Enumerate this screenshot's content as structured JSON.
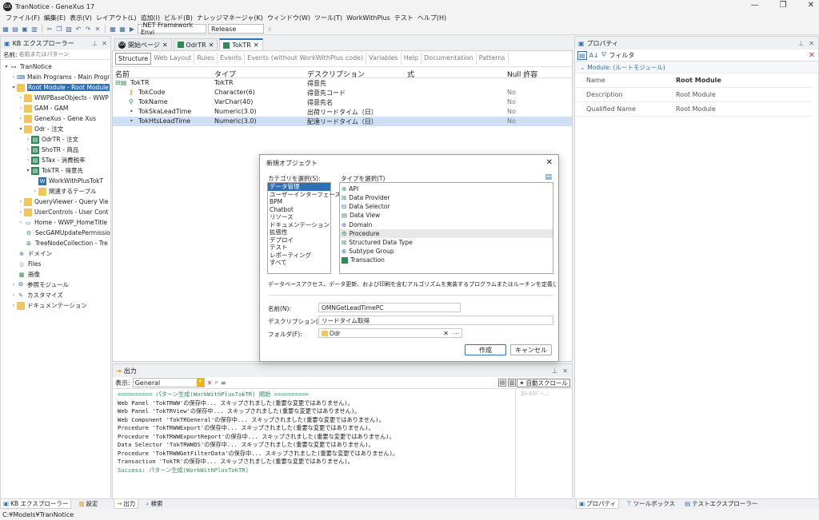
{
  "window": {
    "title": "TranNotice - GeneXus 17",
    "logo_text": "GX",
    "controls": [
      "—",
      "❐",
      "✕"
    ]
  },
  "menu": [
    "ファイル(F)",
    "編集(E)",
    "表示(V)",
    "レイアウト(L)",
    "追加(I)",
    "ビルド(B)",
    "ナレッジマネージャ(K)",
    "ウィンドウ(W)",
    "ツール(T)",
    "WorkWithPlus",
    "テスト",
    "ヘルプ(H)"
  ],
  "toolbar": {
    "environment": ".NET Framework Envi",
    "configuration": "Release"
  },
  "kb_explorer": {
    "title": "KB エクスプローラー",
    "search_label": "名前:",
    "search_placeholder": "名前またはパターン",
    "items": [
      {
        "label": "TranNotice",
        "icon": "kb-root-icon"
      },
      {
        "label": "Main Programs - Main Progr",
        "icon": "main-programs-icon"
      },
      {
        "label": "Root Module - Root Module",
        "icon": "module-icon",
        "selected": true
      },
      {
        "label": "WWPBaseObjects - WWP",
        "icon": "folder-icon"
      },
      {
        "label": "GAM - GAM",
        "icon": "folder-icon"
      },
      {
        "label": "GeneXus - Gene Xus",
        "icon": "folder-icon"
      },
      {
        "label": "Odr - 注文",
        "icon": "folder-icon"
      },
      {
        "label": "OdrTR - 注文",
        "icon": "transaction-icon"
      },
      {
        "label": "ShoTR - 商品",
        "icon": "transaction-icon"
      },
      {
        "label": "STax - 消費税率",
        "icon": "transaction-icon"
      },
      {
        "label": "TokTR - 得意先",
        "icon": "transaction-icon"
      },
      {
        "label": "WorkWithPlusTokT",
        "icon": "workwithplus-icon"
      },
      {
        "label": "関連するテーブル",
        "icon": "folder-icon"
      },
      {
        "label": "QueryViewer - Query Vie",
        "icon": "folder-icon"
      },
      {
        "label": "UserControls - User Cont",
        "icon": "folder-icon"
      },
      {
        "label": "Home - WWP_HomeTitle",
        "icon": "web-panel-icon"
      },
      {
        "label": "SecGAMUpdatePermissio",
        "icon": "procedure-icon"
      },
      {
        "label": "TreeNodeCollection - Tre",
        "icon": "sdt-icon"
      },
      {
        "label": "ドメイン",
        "icon": "domain-icon"
      },
      {
        "label": "Files",
        "icon": "files-icon"
      },
      {
        "label": "画像",
        "icon": "images-icon"
      },
      {
        "label": "参照モジュール",
        "icon": "references-icon"
      },
      {
        "label": "カスタマイズ",
        "icon": "customize-icon"
      },
      {
        "label": "ドキュメンテーション",
        "icon": "documentation-icon"
      }
    ]
  },
  "document_tabs": [
    {
      "label": "開始ページ"
    },
    {
      "label": "OdrTR"
    },
    {
      "label": "TokTR",
      "active": true
    }
  ],
  "sub_tabs": [
    "Structure",
    "Web Layout",
    "Rules",
    "Events",
    "Events (without WorkWithPlus code)",
    "Variables",
    "Help",
    "Documentation",
    "Patterns"
  ],
  "structure": {
    "headers": [
      "名前",
      "タイプ",
      "デスクリプション",
      "式",
      "Null 許容"
    ],
    "rows": [
      {
        "name": "TokTR",
        "type": "TokTR",
        "desc": "得意先",
        "formula": "",
        "nullable": ""
      },
      {
        "name": "TokCode",
        "type": "Character(6)",
        "desc": "得意先コード",
        "formula": "",
        "nullable": "No"
      },
      {
        "name": "TokName",
        "type": "VarChar(40)",
        "desc": "得意先名",
        "formula": "",
        "nullable": "No"
      },
      {
        "name": "TokSkaLeadTime",
        "type": "Numeric(3.0)",
        "desc": "出荷リードタイム（日）",
        "formula": "",
        "nullable": "No"
      },
      {
        "name": "TokHtsLeadTime",
        "type": "Numeric(3.0)",
        "desc": "配達リードタイム（日）",
        "formula": "",
        "nullable": "No"
      }
    ]
  },
  "properties": {
    "title": "プロパティ",
    "filter_label": "フィルタ",
    "group": "Module: (ルートモジュール)",
    "rows": [
      {
        "name": "Name",
        "value": "Root Module"
      },
      {
        "name": "Description",
        "value": "Root Module"
      },
      {
        "name": "Qualified Name",
        "value": "Root Module"
      }
    ]
  },
  "dialog": {
    "title": "新規オブジェクト",
    "category_label": "カテゴリを選択(S):",
    "type_label": "タイプを選択(T)",
    "categories": [
      "データ管理",
      "ユーザーインターフェース",
      "BPM",
      "Chatbot",
      "リソース",
      "ドキュメンテーション",
      "拡張性",
      "デプロイ",
      "テスト",
      "レポーティング",
      "すべて"
    ],
    "types": [
      "API",
      "Data Provider",
      "Data Selector",
      "Data View",
      "Domain",
      "Procedure",
      "Structured Data Type",
      "Subtype Group",
      "Transaction"
    ],
    "description": "データベースアクセス、データ更新、および印刷を含むアルゴリズムを実装するプログラムまたはルーチンを定義します。",
    "name_label": "名前(N):",
    "name_value": "OMNGetLeadTimePC",
    "desc_label": "デスクリプション(D):",
    "desc_value": "リードタイム取得",
    "folder_label": "フォルダ(F):",
    "folder_value": "Odr",
    "create_label": "作成",
    "cancel_label": "キャンセル"
  },
  "output": {
    "title": "出力",
    "show_label": "表示:",
    "show_value": "General",
    "autoscroll_label": "自動スクロール",
    "progress_label": "ｽﾃｰﾀｽﾊﾞｰ...",
    "lines": [
      "========== パターン生成(WorkWithPlusTokTR) 開始 ==========",
      "Web Panel 'TokTRWW'の保存中... スキップされました(重要な変更ではありません)。",
      "Web Panel 'TokTRView'の保存中... スキップされました(重要な変更ではありません)。",
      "Web Component 'TokTRGeneral'の保存中... スキップされました(重要な変更ではありません)。",
      "Procedure 'TokTRWWExport'の保存中... スキップされました(重要な変更ではありません)。",
      "Procedure 'TokTRWWExportReport'の保存中... スキップされました(重要な変更ではありません)。",
      "Data Selector 'TokTRWWDS'の保存中... スキップされました(重要な変更ではありません)。",
      "Procedure 'TokTRWWGetFilterData'の保存中... スキップされました(重要な変更ではありません)。",
      "Transaction 'TokTR'の保存中... スキップされました(重要な変更ではありません)。",
      "Success: パターン生成(WorkWithPlusTokTR)"
    ]
  },
  "bottom_tabs": {
    "left": [
      "KB エクスプローラー",
      "設定"
    ],
    "output": [
      "出力",
      "検索"
    ],
    "right": [
      "プロパティ",
      "ツールボックス",
      "テストエクスプローラー"
    ]
  },
  "status": {
    "path": "C:¥Models¥TranNotice"
  },
  "colors": {
    "accent": "#2f6fb7",
    "selection": "#cfe0f5",
    "success": "#2e8b57",
    "output_header": "#2e8b57"
  }
}
